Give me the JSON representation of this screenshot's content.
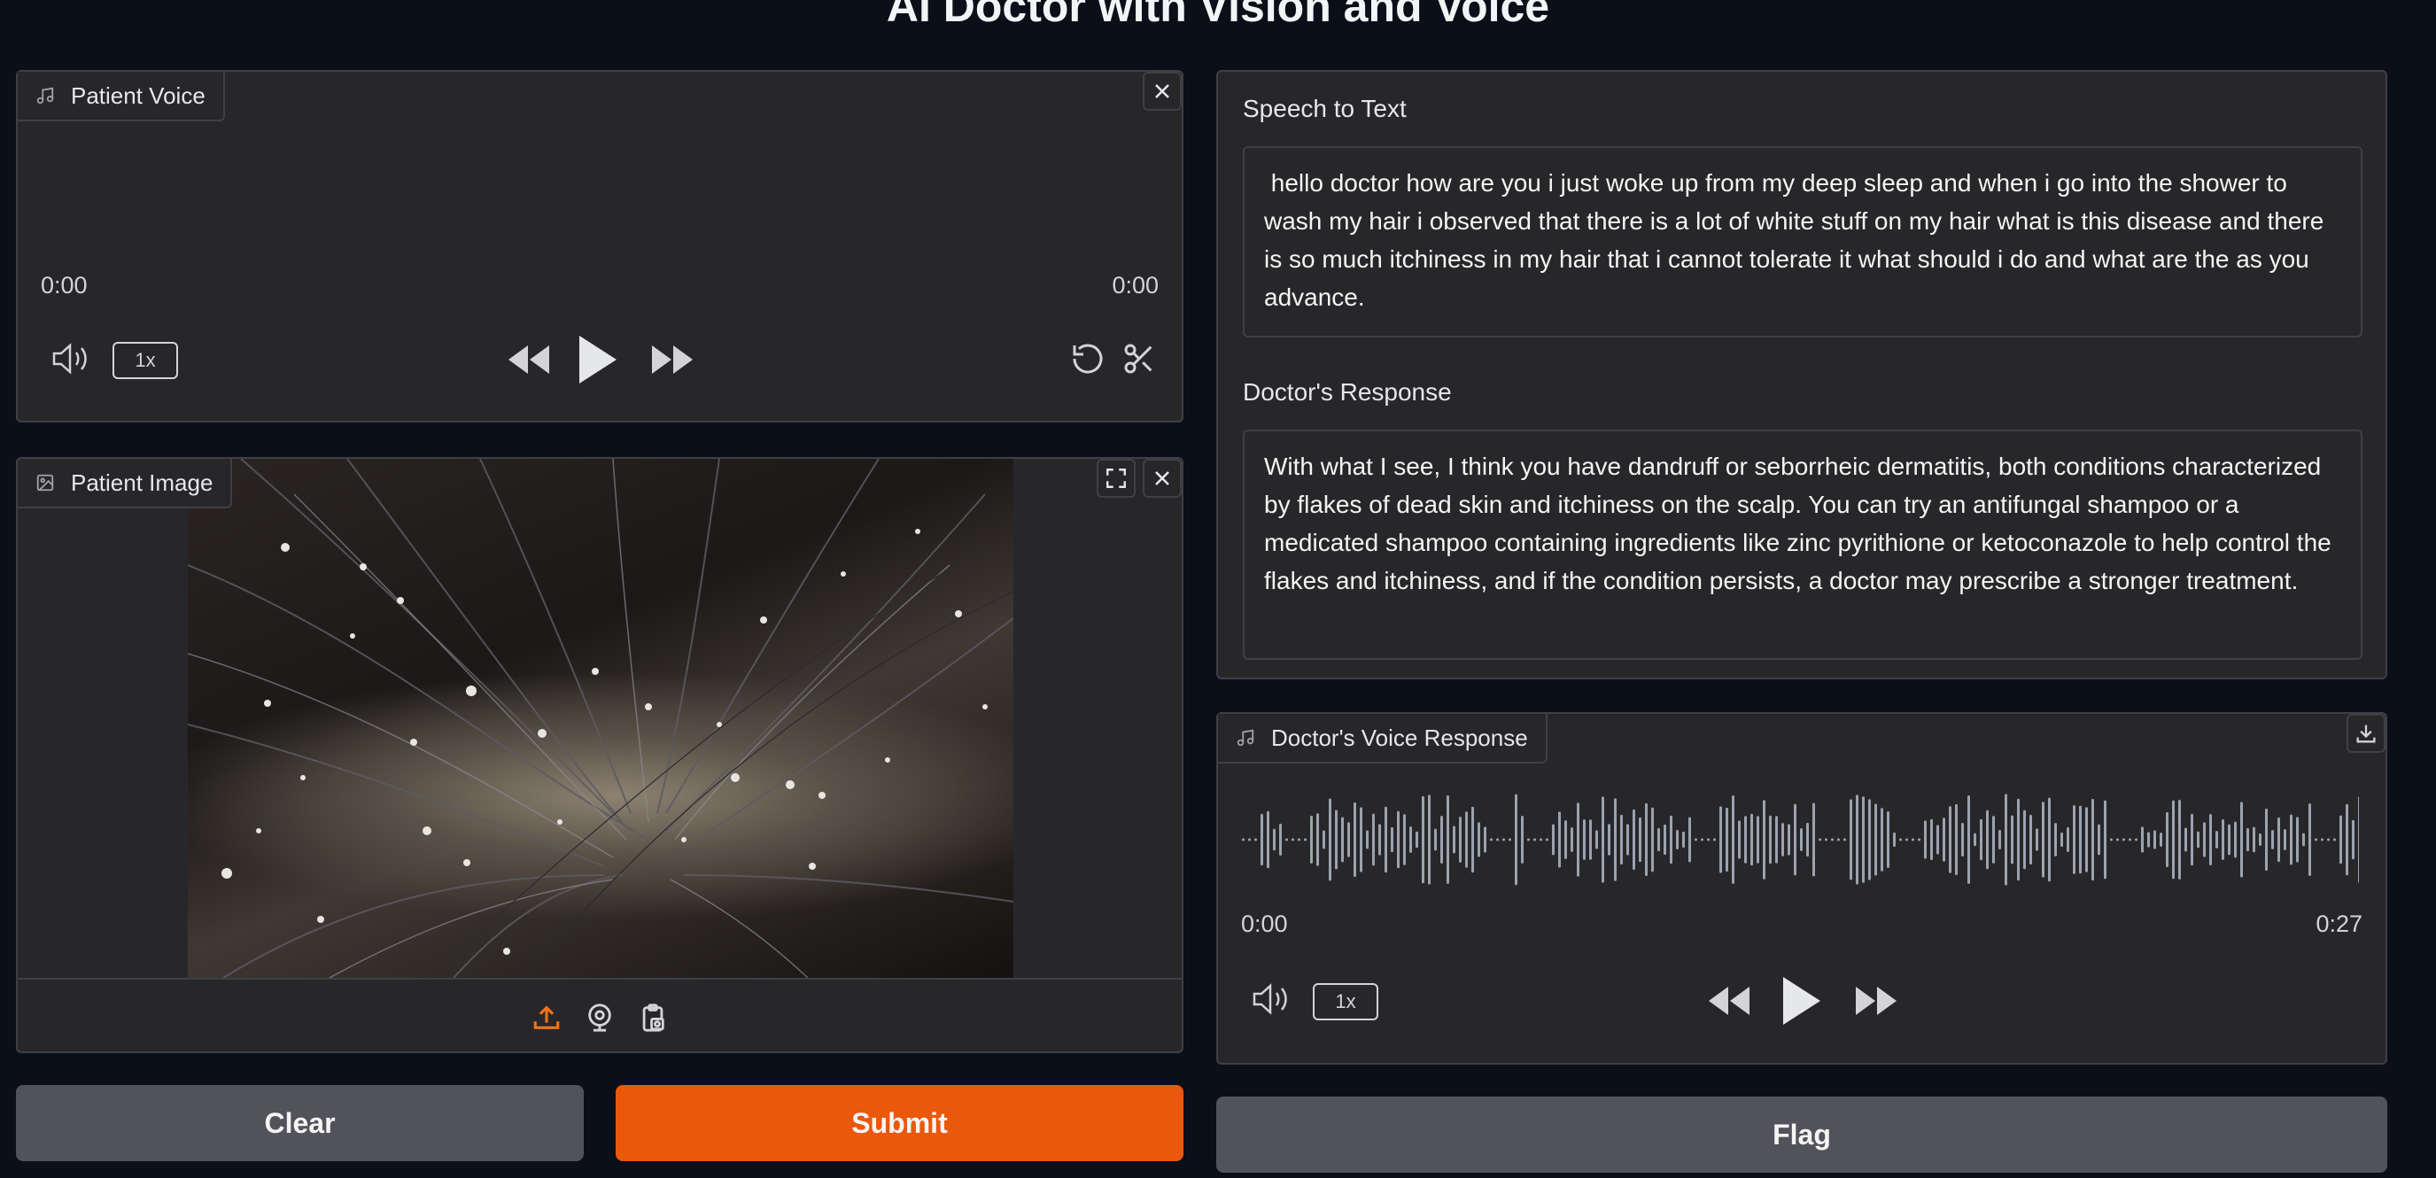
{
  "app_title": "AI Doctor with Vision and Voice",
  "patient_voice": {
    "label": "Patient Voice",
    "time_current": "0:00",
    "time_total": "0:00",
    "speed": "1x"
  },
  "patient_image": {
    "label": "Patient Image"
  },
  "speech_to_text": {
    "label": "Speech to Text",
    "value": " hello doctor how are you i just woke up from my deep sleep and when i go into the shower to wash my hair i observed that there is a lot of white stuff on my hair what is this disease and there is so much itchiness in my hair that i cannot tolerate it what should i do and what are the as you advance."
  },
  "doctor_response": {
    "label": "Doctor's Response",
    "value": "With what I see, I think you have dandruff or seborrheic dermatitis, both conditions characterized by flakes of dead skin and itchiness on the scalp. You can try an antifungal shampoo or a medicated shampoo containing ingredients like zinc pyrithione or ketoconazole to help control the flakes and itchiness, and if the condition persists, a doctor may prescribe a stronger treatment."
  },
  "doctor_voice": {
    "label": "Doctor's Voice Response",
    "time_current": "0:00",
    "time_total": "0:27",
    "speed": "1x"
  },
  "buttons": {
    "clear": "Clear",
    "submit": "Submit",
    "flag": "Flag"
  },
  "colors": {
    "accent": "#ea580c",
    "secondary_button": "#52525b",
    "panel": "#27272a",
    "background": "#0b0f19"
  }
}
